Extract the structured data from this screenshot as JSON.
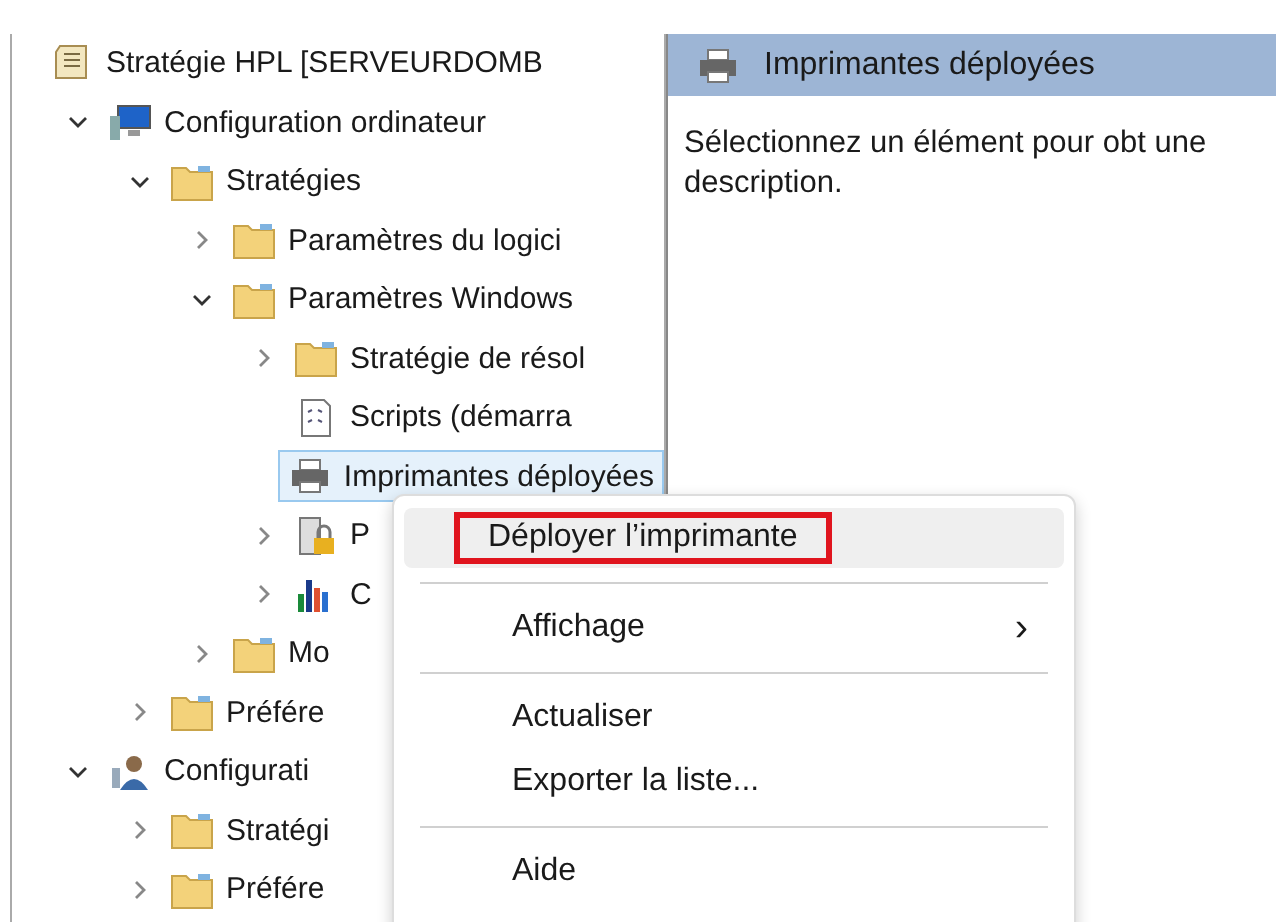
{
  "tree": [
    {
      "label": "Stratégie HPL [SERVEURDOMB",
      "kind": "policy",
      "children": [
        {
          "label": "Configuration ordinateur",
          "kind": "computer",
          "expanded": true,
          "children": [
            {
              "label": "Stratégies",
              "kind": "folder",
              "expanded": true,
              "children": [
                {
                  "label": "Paramètres du logici",
                  "kind": "folder",
                  "expanded": false
                },
                {
                  "label": "Paramètres Windows",
                  "kind": "folder",
                  "expanded": true,
                  "children": [
                    {
                      "label": "Stratégie de résol",
                      "kind": "folder",
                      "expanded": false
                    },
                    {
                      "label": "Scripts (démarra",
                      "kind": "script"
                    },
                    {
                      "label": "Imprimantes déployées",
                      "kind": "printer",
                      "selected": true
                    },
                    {
                      "label": "P",
                      "kind": "lock",
                      "expanded": false
                    },
                    {
                      "label": "C",
                      "kind": "chart",
                      "expanded": false
                    }
                  ]
                },
                {
                  "label": "Mo",
                  "kind": "folder",
                  "expanded": false
                }
              ]
            },
            {
              "label": "Préfére",
              "kind": "folder",
              "expanded": false
            }
          ]
        },
        {
          "label": "Configurati",
          "kind": "user",
          "expanded": true,
          "children": [
            {
              "label": "Stratégi",
              "kind": "folder",
              "expanded": false
            },
            {
              "label": "Préfére",
              "kind": "folder",
              "expanded": false
            }
          ]
        }
      ]
    }
  ],
  "detail": {
    "title": "Imprimantes déployées",
    "description": "Sélectionnez un élément pour obt une description."
  },
  "menu": [
    {
      "kind": "item",
      "label": "Déployer l’imprimante",
      "selected": true,
      "annotated": true
    },
    {
      "kind": "separator"
    },
    {
      "kind": "item",
      "label": "Affichage",
      "selected": false,
      "annotated": false,
      "submenu_icon": "›"
    },
    {
      "kind": "separator"
    },
    {
      "kind": "item",
      "label": "Actualiser",
      "selected": false,
      "annotated": false
    },
    {
      "kind": "item",
      "label": "Exporter la liste...",
      "selected": false,
      "annotated": false
    },
    {
      "kind": "separator"
    },
    {
      "kind": "item",
      "label": "Aide",
      "selected": false,
      "annotated": false
    }
  ]
}
